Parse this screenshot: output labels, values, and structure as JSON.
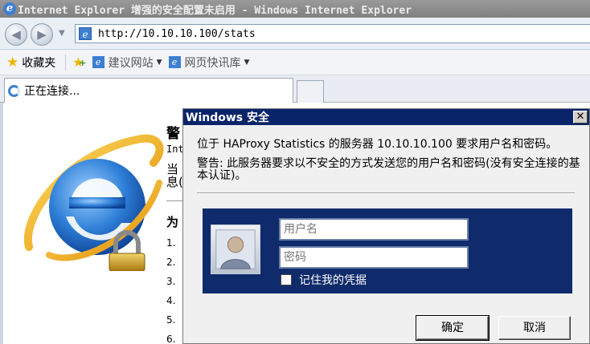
{
  "window": {
    "title": "Internet Explorer 增强的安全配置未启用 - Windows Internet Explorer"
  },
  "navigation": {
    "address": "http://10.10.10.100/stats",
    "back_icon": "back-arrow-icon",
    "forward_icon": "forward-arrow-icon"
  },
  "favorites_bar": {
    "favorites_label": "收藏夹",
    "links": [
      {
        "label": "建议网站",
        "icon": "ie-page-icon"
      },
      {
        "label": "网页快讯库",
        "icon": "ie-page-icon"
      }
    ]
  },
  "tab": {
    "label": "正在连接..."
  },
  "page": {
    "heading": "警",
    "line_small": "Int",
    "line_para1": "当",
    "line_para2": "息(",
    "heading2": "为",
    "numbers": [
      "1.",
      "2.",
      "3.",
      "4.",
      "5.",
      "6."
    ]
  },
  "dialog": {
    "title": "Windows 安全",
    "message": "位于 HAProxy Statistics 的服务器 10.10.10.100 要求用户名和密码。",
    "warning": "警告: 此服务器要求以不安全的方式发送您的用户名和密码(没有安全连接的基本认证)。",
    "username_placeholder": "用户名",
    "password_placeholder": "密码",
    "remember_label": "记住我的凭据",
    "remember_checked": false,
    "ok_label": "确定",
    "cancel_label": "取消"
  },
  "colors": {
    "dialog_title_bg": "#0a246a",
    "credential_panel_bg": "#0f2b6b",
    "ie_blue": "#3d7fd1"
  }
}
